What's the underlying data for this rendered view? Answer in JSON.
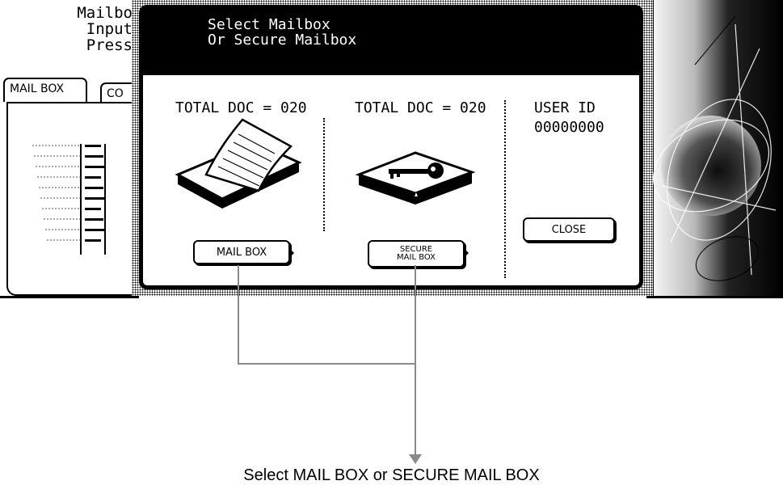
{
  "background_screen": {
    "title_lines": [
      "Mailbo",
      "Input",
      "Press"
    ],
    "tabs": [
      {
        "label": "MAIL BOX"
      },
      {
        "label": "CO"
      }
    ]
  },
  "dialog": {
    "title": "Select Mailbox\nOr Secure Mailbox",
    "mailbox_total": "TOTAL DOC = 020",
    "secure_total": "TOTAL DOC = 020",
    "user_id_label": "USER ID",
    "user_id_value": "00000000",
    "mail_box_button": "MAIL BOX",
    "secure_button_line1": "SECURE",
    "secure_button_line2": "MAIL BOX",
    "close_button": "CLOSE"
  },
  "icons": {
    "mailbox": "mail-tray-icon",
    "secure": "locked-box-key-icon"
  },
  "callout": {
    "text": "Select MAIL BOX or SECURE MAIL BOX"
  },
  "colors": {
    "header_bg": "#000000",
    "callout_line": "#8a8a8a"
  }
}
